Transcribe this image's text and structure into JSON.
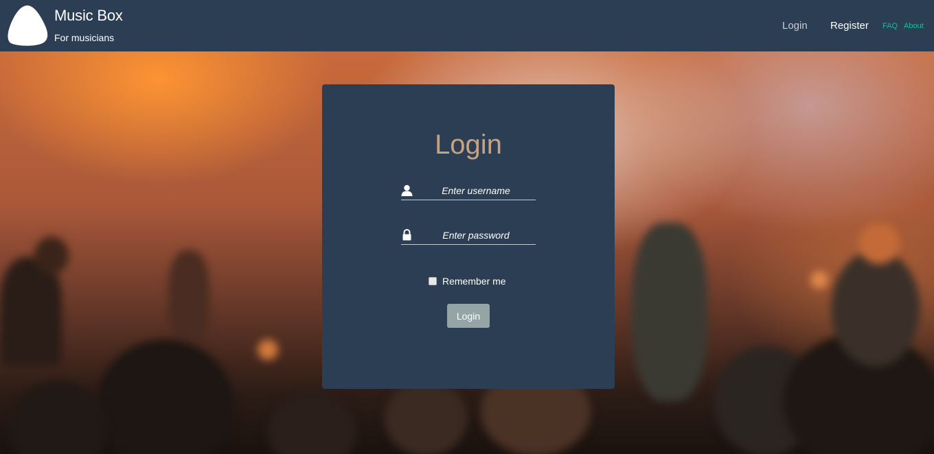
{
  "header": {
    "brand_title": "Music Box",
    "brand_subtitle": "For musicians",
    "nav": {
      "login": "Login",
      "register": "Register",
      "faq": "FAQ",
      "about": "About"
    }
  },
  "login_form": {
    "title": "Login",
    "username": {
      "value": "",
      "placeholder": "Enter username",
      "icon": "user-icon"
    },
    "password": {
      "value": "",
      "placeholder": "Enter password",
      "icon": "lock-icon"
    },
    "remember": {
      "label": "Remember me",
      "checked": false
    },
    "submit_label": "Login"
  },
  "colors": {
    "header_bg": "#2c3e53",
    "card_bg": "#2c3e53",
    "title_color": "#c7a281",
    "link_accent": "#1abc9c",
    "button_bg": "#95a5a6"
  }
}
